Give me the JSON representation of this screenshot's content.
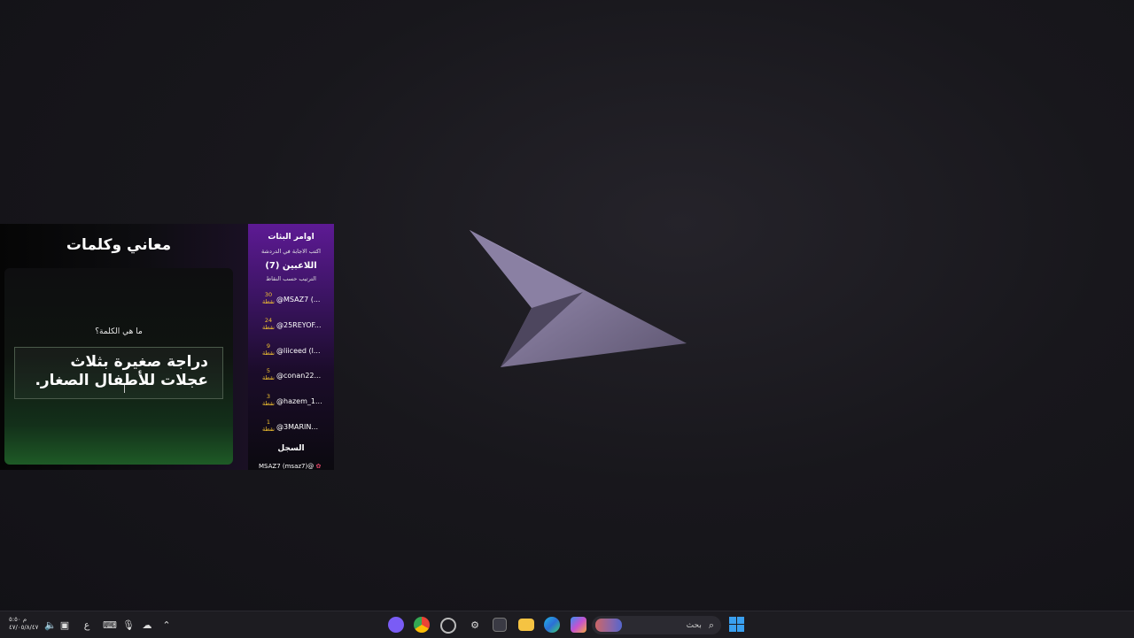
{
  "overlay": {
    "title": "معاني وكلمات",
    "question_label": "ما هي الكلمة؟",
    "answer_text": "دراجة صغيرة بثلاث عجلات للأطفال الصغار."
  },
  "players_panel": {
    "commands_title": "اوامر البثات",
    "hint": "اكتب الاجابة في الدردشة",
    "players_count": "اللاعبين (7)",
    "sort_hint": "الترتيب حسب النقاط",
    "points_word": "نقطة",
    "players": [
      {
        "points": "30",
        "name": "@MSAZ7 (..."
      },
      {
        "points": "24",
        "name": "@25REYOF..."
      },
      {
        "points": "9",
        "name": "@liiceed (l..."
      },
      {
        "points": "5",
        "name": "@conan22..."
      },
      {
        "points": "3",
        "name": "@hazem_1..."
      },
      {
        "points": "1",
        "name": "@3MARIN..."
      }
    ],
    "log_title": "السجل",
    "log_entry": "MSAZ7 (msaz7)@"
  },
  "taskbar": {
    "search_label": "بحث",
    "clock_time": "م ٥:٥٠",
    "clock_date": "٤٧/٠٥/٨/٤٧",
    "lang": "ع"
  },
  "colors": {
    "panel_purple": "#5d1a94",
    "points_gold": "#f4c430",
    "windows_blue": "#3aa0f0"
  }
}
